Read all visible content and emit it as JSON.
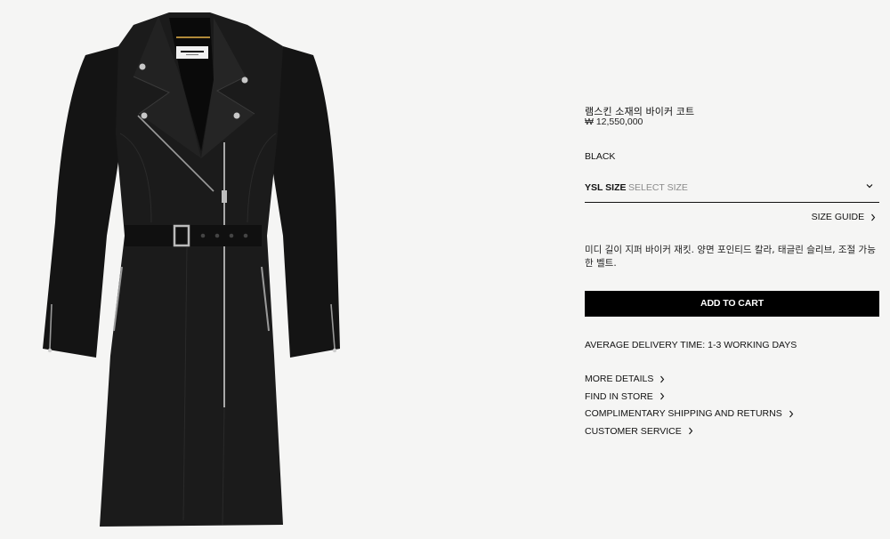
{
  "product": {
    "title": "램스킨 소재의 바이커 코트",
    "price": "₩ 12,550,000",
    "color": "BLACK",
    "size": {
      "label": "YSL SIZE",
      "placeholder": "SELECT SIZE",
      "guide_label": "SIZE GUIDE"
    },
    "description": "미디 길이 지퍼 바이커 재킷. 양면 포인티드 칼라, 태글린 슬리브, 조절 가능한 벨트.",
    "add_to_cart_label": "ADD TO CART",
    "delivery": "AVERAGE DELIVERY TIME: 1-3 WORKING DAYS",
    "links": [
      {
        "label": "MORE DETAILS"
      },
      {
        "label": "FIND IN STORE"
      },
      {
        "label": "COMPLIMENTARY SHIPPING AND RETURNS"
      },
      {
        "label": "CUSTOMER SERVICE"
      }
    ],
    "label_text": "SAINT LAURENT"
  },
  "colors": {
    "background": "#f5f5f4",
    "accent": "#000000",
    "muted_text": "#8a8a8a"
  },
  "icons": {
    "dropdown": "chevron-down-icon",
    "link": "chevron-right-icon"
  }
}
